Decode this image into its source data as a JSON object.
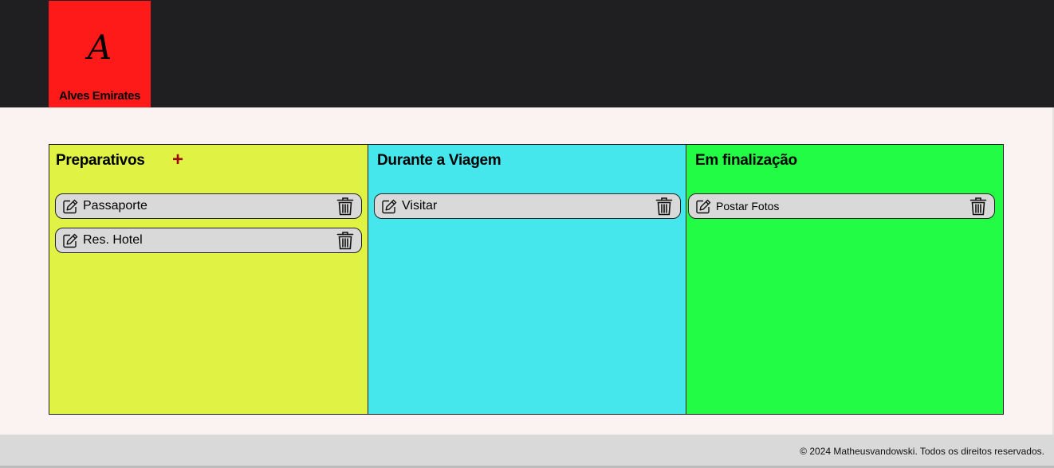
{
  "brand": {
    "mark": "A",
    "name": "Alves Emirates",
    "color": "#ff1a1a"
  },
  "columns": [
    {
      "title": "Preparativos",
      "color": "#e0f344",
      "add_label": "+",
      "cards": [
        {
          "label": "Passaporte"
        },
        {
          "label": "Res. Hotel"
        }
      ]
    },
    {
      "title": "Durante a Viagem",
      "color": "#45e6ec",
      "cards": [
        {
          "label": "Visitar"
        }
      ]
    },
    {
      "title": "Em finalização",
      "color": "#22fc44",
      "cards": [
        {
          "label": "Postar Fotos"
        }
      ]
    }
  ],
  "icons": {
    "edit": "pencil-square-icon",
    "delete": "trash-icon"
  },
  "footer": {
    "text": "© 2024 Matheusvandowski. Todos os direitos reservados."
  }
}
